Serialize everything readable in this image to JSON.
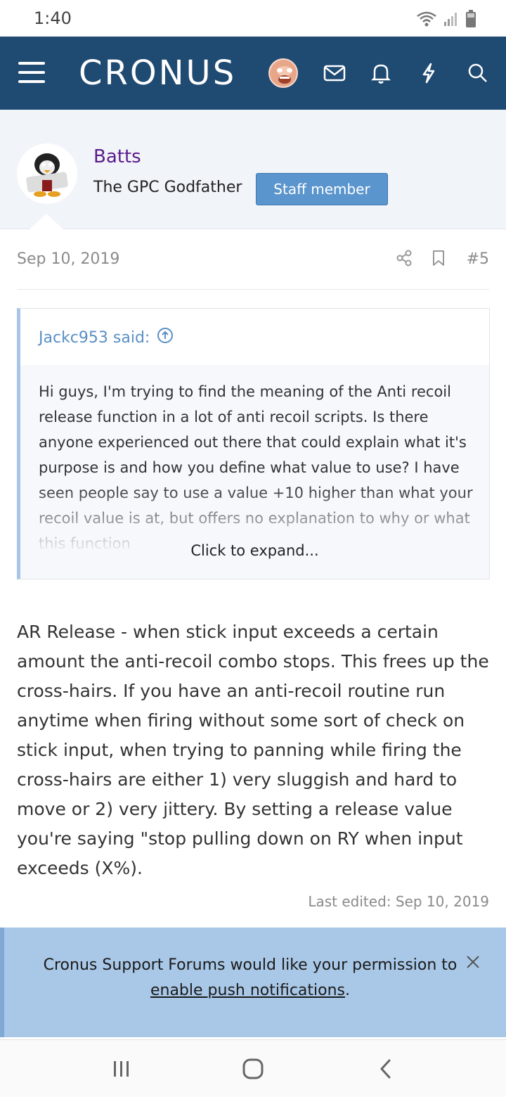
{
  "status_bar": {
    "time": "1:40"
  },
  "header": {
    "logo": "CRONUS"
  },
  "poster": {
    "name": "Batts",
    "title": "The GPC Godfather",
    "badge": "Staff member"
  },
  "post_meta": {
    "date": "Sep 10, 2019",
    "number": "#5"
  },
  "quote": {
    "author": "Jackc953 said:",
    "text": "Hi guys, I'm trying to find the meaning of the Anti recoil release function in a lot of anti recoil scripts. Is there anyone experienced out there that could explain what it's purpose is and how you define what value to use? I have seen people say to use a value +10 higher than what your recoil value is at, but offers no explanation to why or what this function",
    "expand_label": "Click to expand..."
  },
  "post_body": "AR Release - when stick input exceeds a certain amount the anti-recoil combo stops. This frees up the cross-hairs. If you have an anti-recoil routine run anytime when firing without some sort of check on stick input, when trying to panning while firing the cross-hairs are either 1) very sluggish and hard to move or 2) very jittery. By setting a release value you're saying \"stop pulling down on RY when input exceeds (X%).",
  "last_edited": "Last edited: Sep 10, 2019",
  "notice": {
    "text_before": "Cronus Support Forums would like your permission to ",
    "link": "enable push notifications",
    "text_after": "."
  },
  "colors": {
    "header_bg": "#1f4a72",
    "username": "#5b1b8b",
    "badge_bg": "#5a95cd",
    "quote_author": "#5a8fc4",
    "notice_bg": "#a9c8e7"
  }
}
